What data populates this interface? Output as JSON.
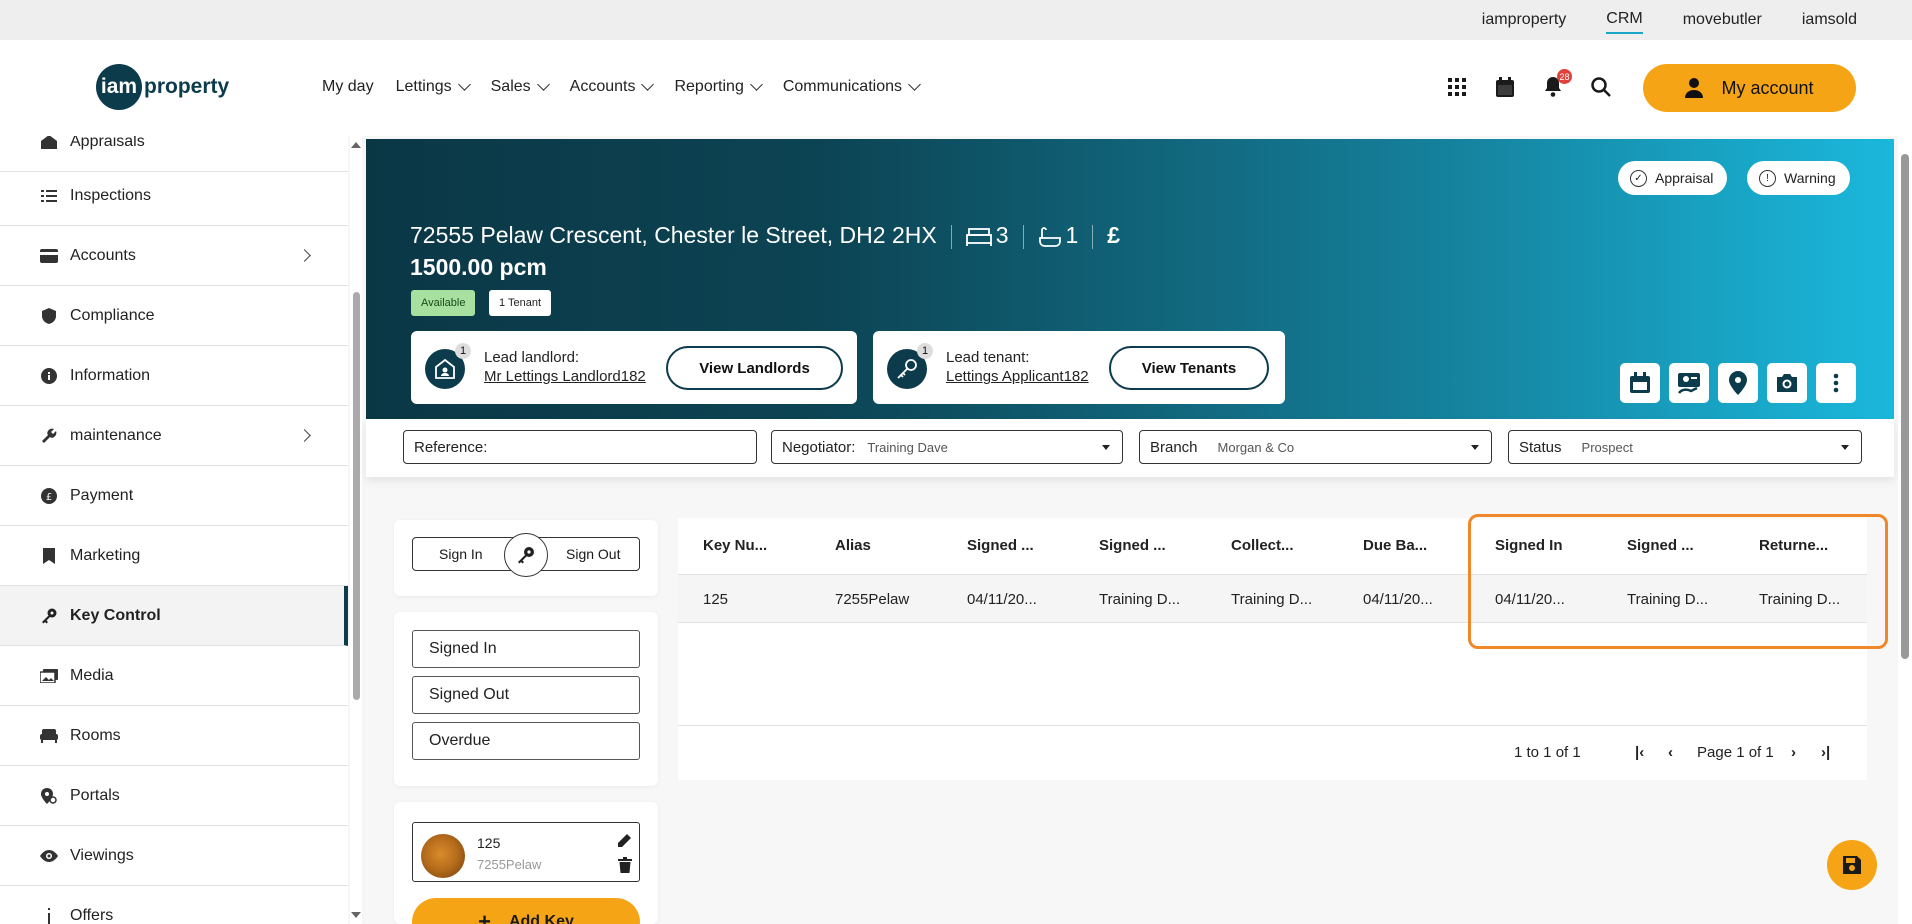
{
  "topbar": {
    "links": [
      "iamproperty",
      "CRM",
      "movebutler",
      "iamsold"
    ]
  },
  "header": {
    "logo_mark": "iam",
    "logo_word": "property",
    "nav": [
      "My day",
      "Lettings",
      "Sales",
      "Accounts",
      "Reporting",
      "Communications"
    ],
    "notification_count": "28",
    "account_label": "My account"
  },
  "sidebar": {
    "items": [
      "Appraisals",
      "Inspections",
      "Accounts",
      "Compliance",
      "Information",
      "maintenance",
      "Payment",
      "Marketing",
      "Key Control",
      "Media",
      "Rooms",
      "Portals",
      "Viewings",
      "Offers"
    ]
  },
  "property": {
    "address": "72555 Pelaw Crescent, Chester le Street, DH2 2HX",
    "bedrooms": "3",
    "bathrooms": "1",
    "currency": "£",
    "price": "1500.00 pcm",
    "status_chip": "Available",
    "tenant_chip": "1 Tenant",
    "pills": [
      "Appraisal",
      "Warning"
    ],
    "landlord": {
      "label": "Lead landlord:",
      "name": "Mr Lettings Landlord182",
      "button": "View Landlords",
      "count": "1"
    },
    "tenant": {
      "label": "Lead tenant:",
      "name": "Lettings Applicant182",
      "button": "View Tenants",
      "count": "1"
    }
  },
  "filters": {
    "reference_label": "Reference:",
    "negotiator_label": "Negotiator:",
    "negotiator_value": "Training Dave",
    "branch_label": "Branch",
    "branch_value": "Morgan & Co",
    "status_label": "Status",
    "status_value": "Prospect"
  },
  "key_panel": {
    "sign_in": "Sign In",
    "sign_out": "Sign Out",
    "filter_buttons": [
      "Signed In",
      "Signed Out",
      "Overdue"
    ],
    "key_number": "125",
    "key_alias": "7255Pelaw",
    "add_key": "Add Key"
  },
  "table": {
    "headers": [
      "Key Nu...",
      "Alias",
      "Signed ...",
      "Signed ...",
      "Collect...",
      "Due Ba...",
      "Signed In",
      "Signed ...",
      "Returne..."
    ],
    "rows": [
      [
        "125",
        "7255Pelaw",
        "04/11/20...",
        "Training D...",
        "Training D...",
        "04/11/20...",
        "04/11/20...",
        "Training D...",
        "Training D..."
      ]
    ],
    "range": "1 to 1 of 1",
    "page": "Page 1 of 1"
  },
  "colors": {
    "accent": "#f5a416",
    "brand": "#0c3b4c",
    "highlight": "#f0882a"
  }
}
